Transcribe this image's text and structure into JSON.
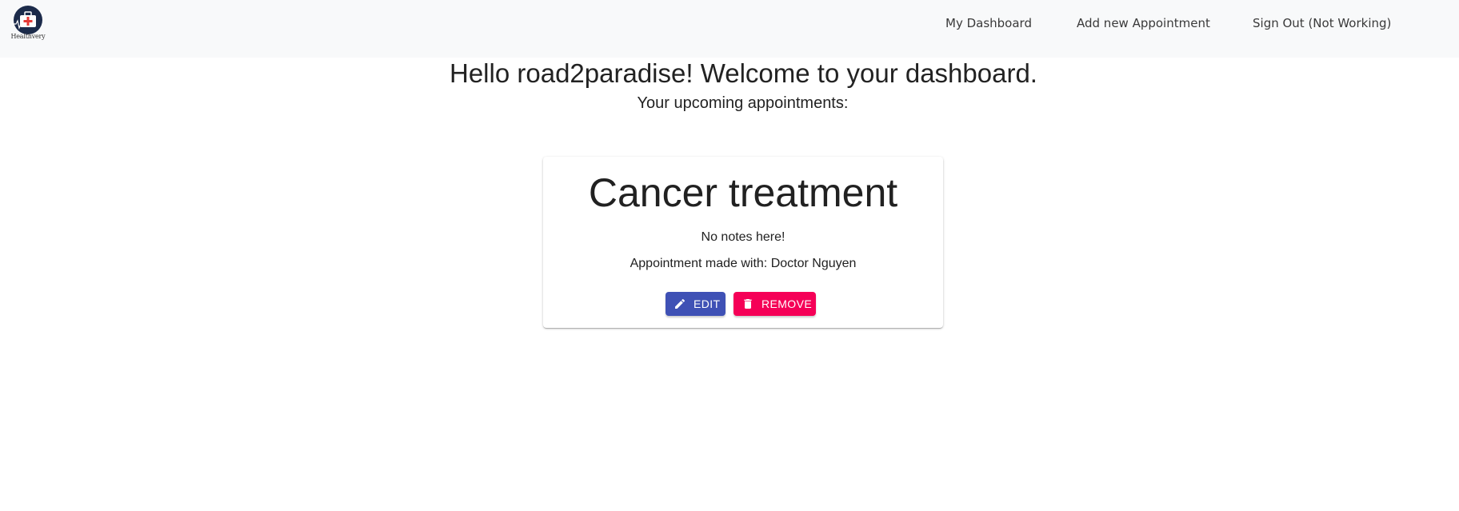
{
  "navbar": {
    "logo_text": "Healthvery",
    "links": {
      "dashboard": "My Dashboard",
      "add_appointment": "Add new Appointment",
      "sign_out": "Sign Out (Not Working)"
    }
  },
  "main": {
    "greeting": "Hello road2paradise! Welcome to your dashboard.",
    "subheading": "Your upcoming appointments:"
  },
  "appointment": {
    "title": "Cancer treatment",
    "notes": "No notes here!",
    "doctor": "Appointment made with: Doctor Nguyen",
    "edit_label": "EDIT",
    "remove_label": "REMOVE"
  },
  "colors": {
    "navbar_bg": "#f8f9fa",
    "edit_button": "#3f51b5",
    "remove_button": "#f50057",
    "logo_bg": "#1c2b4a",
    "logo_cross": "#e53935"
  },
  "icons": {
    "logo": "medical-kit-icon",
    "edit": "pencil-icon",
    "remove": "trash-icon"
  }
}
